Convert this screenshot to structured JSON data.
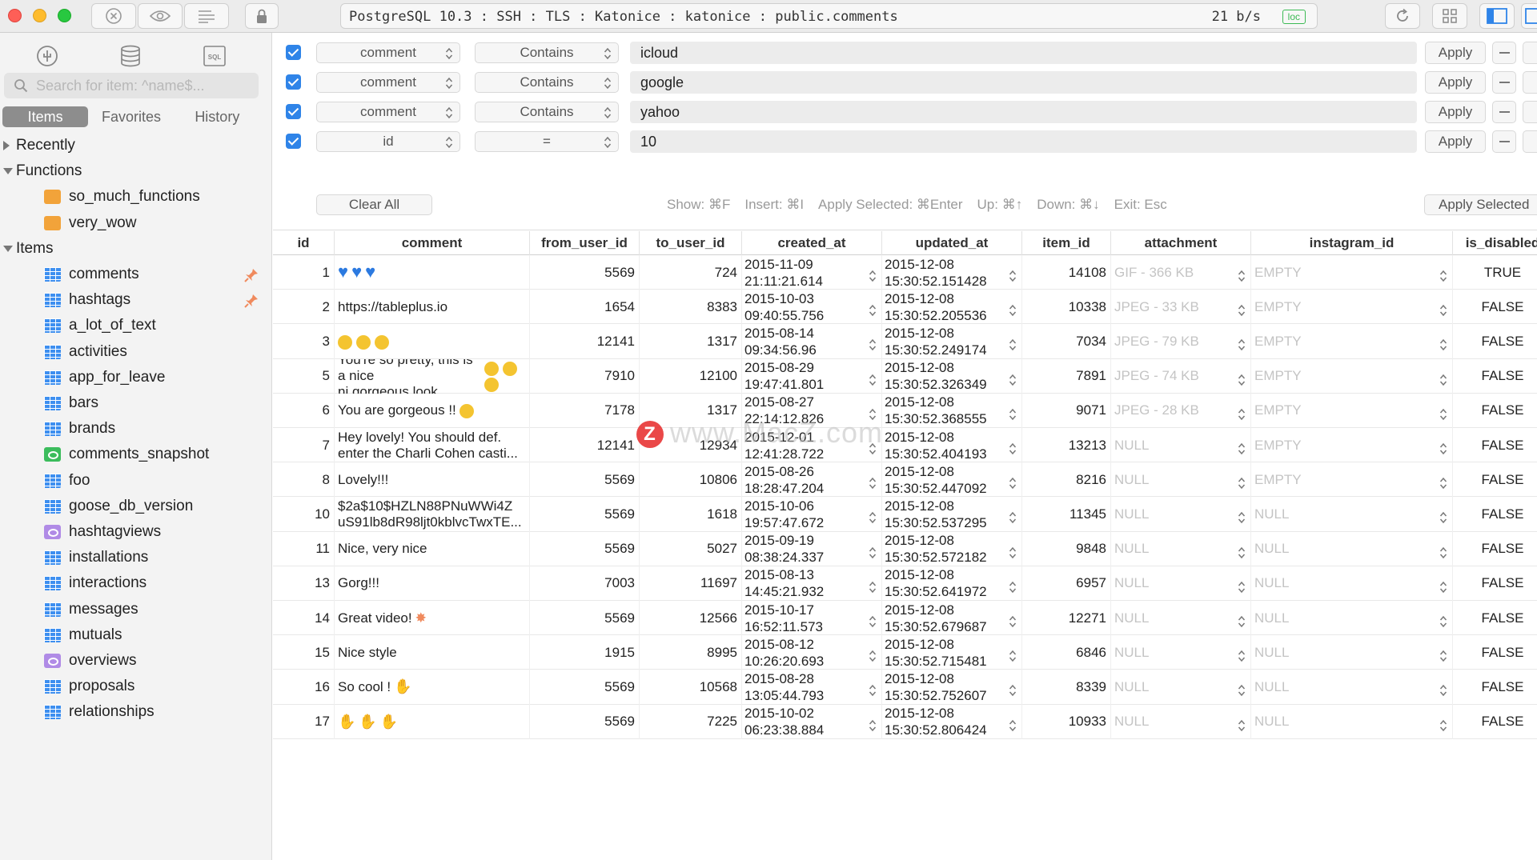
{
  "titlebar": {
    "connection": "PostgreSQL 10.3 : SSH : TLS : Katonice : katonice : public.comments",
    "speed": "21 b/s",
    "badge": "loc"
  },
  "sidebar": {
    "search_placeholder": "Search for item: ^name$...",
    "segments": [
      "Items",
      "Favorites",
      "History"
    ],
    "active_segment": "Items",
    "groups": {
      "recently": "Recently",
      "functions": "Functions",
      "items": "Items"
    },
    "functions": [
      "so_much_functions",
      "very_wow"
    ],
    "items": [
      {
        "label": "comments",
        "kind": "table",
        "pinned": true
      },
      {
        "label": "hashtags",
        "kind": "table",
        "pinned": true
      },
      {
        "label": "a_lot_of_text",
        "kind": "table"
      },
      {
        "label": "activities",
        "kind": "table"
      },
      {
        "label": "app_for_leave",
        "kind": "table"
      },
      {
        "label": "bars",
        "kind": "table"
      },
      {
        "label": "brands",
        "kind": "table"
      },
      {
        "label": "comments_snapshot",
        "kind": "materialized-view"
      },
      {
        "label": "foo",
        "kind": "table"
      },
      {
        "label": "goose_db_version",
        "kind": "table"
      },
      {
        "label": "hashtagviews",
        "kind": "view"
      },
      {
        "label": "installations",
        "kind": "table"
      },
      {
        "label": "interactions",
        "kind": "table"
      },
      {
        "label": "messages",
        "kind": "table"
      },
      {
        "label": "mutuals",
        "kind": "table"
      },
      {
        "label": "overviews",
        "kind": "view"
      },
      {
        "label": "proposals",
        "kind": "table"
      },
      {
        "label": "relationships",
        "kind": "table"
      }
    ]
  },
  "filters": {
    "rows": [
      {
        "column": "comment",
        "operator": "Contains",
        "value": "icloud"
      },
      {
        "column": "comment",
        "operator": "Contains",
        "value": "google"
      },
      {
        "column": "comment",
        "operator": "Contains",
        "value": "yahoo"
      },
      {
        "column": "id",
        "operator": "=",
        "value": "10"
      }
    ],
    "apply_label": "Apply",
    "clear_all": "Clear All",
    "hints": [
      "Show: ⌘F",
      "Insert: ⌘I",
      "Apply Selected: ⌘Enter",
      "Up: ⌘↑",
      "Down: ⌘↓",
      "Exit: Esc"
    ],
    "apply_selected": "Apply Selected"
  },
  "table": {
    "columns": [
      "id",
      "comment",
      "from_user_id",
      "to_user_id",
      "created_at",
      "updated_at",
      "item_id",
      "attachment",
      "instagram_id",
      "is_disabled"
    ],
    "rows": [
      {
        "id": "1",
        "comment": "",
        "emoji": "hearts",
        "from_user_id": "5569",
        "to_user_id": "724",
        "created_at": "2015-11-09\n21:11:21.614",
        "updated_at": "2015-12-08\n15:30:52.151428",
        "item_id": "14108",
        "attachment": "GIF - 366 KB",
        "instagram_id": "EMPTY",
        "is_disabled": "TRUE"
      },
      {
        "id": "2",
        "comment": "https://tableplus.io",
        "from_user_id": "1654",
        "to_user_id": "8383",
        "created_at": "2015-10-03\n09:40:55.756",
        "updated_at": "2015-12-08\n15:30:52.205536",
        "item_id": "10338",
        "attachment": "JPEG - 33 KB",
        "instagram_id": "EMPTY",
        "is_disabled": "FALSE"
      },
      {
        "id": "3",
        "comment": "",
        "emoji": "smiles",
        "from_user_id": "12141",
        "to_user_id": "1317",
        "created_at": "2015-08-14\n09:34:56.96",
        "updated_at": "2015-12-08\n15:30:52.249174",
        "item_id": "7034",
        "attachment": "JPEG - 79 KB",
        "instagram_id": "EMPTY",
        "is_disabled": "FALSE"
      },
      {
        "id": "5",
        "comment": "You're so pretty, this is a nice\nni gorgeous look",
        "emoji": "smiles-trail",
        "from_user_id": "7910",
        "to_user_id": "12100",
        "created_at": "2015-08-29\n19:47:41.801",
        "updated_at": "2015-12-08\n15:30:52.326349",
        "item_id": "7891",
        "attachment": "JPEG - 74 KB",
        "instagram_id": "EMPTY",
        "is_disabled": "FALSE"
      },
      {
        "id": "6",
        "comment": "You are gorgeous !!",
        "emoji": "heart-eyes",
        "from_user_id": "7178",
        "to_user_id": "1317",
        "created_at": "2015-08-27\n22:14:12.826",
        "updated_at": "2015-12-08\n15:30:52.368555",
        "item_id": "9071",
        "attachment": "JPEG - 28 KB",
        "instagram_id": "EMPTY",
        "is_disabled": "FALSE"
      },
      {
        "id": "7",
        "comment": "Hey lovely! You should def.\nenter the Charli Cohen casti...",
        "from_user_id": "12141",
        "to_user_id": "12934",
        "created_at": "2015-12-01\n12:41:28.722",
        "updated_at": "2015-12-08\n15:30:52.404193",
        "item_id": "13213",
        "attachment": "NULL",
        "instagram_id": "EMPTY",
        "is_disabled": "FALSE"
      },
      {
        "id": "8",
        "comment": "Lovely!!!",
        "from_user_id": "5569",
        "to_user_id": "10806",
        "created_at": "2015-08-26\n18:28:47.204",
        "updated_at": "2015-12-08\n15:30:52.447092",
        "item_id": "8216",
        "attachment": "NULL",
        "instagram_id": "EMPTY",
        "is_disabled": "FALSE"
      },
      {
        "id": "10",
        "comment": "$2a$10$HZLN88PNuWWi4Z\nuS91lb8dR98ljt0kblvcTwxTE...",
        "from_user_id": "5569",
        "to_user_id": "1618",
        "created_at": "2015-10-06\n19:57:47.672",
        "updated_at": "2015-12-08\n15:30:52.537295",
        "item_id": "11345",
        "attachment": "NULL",
        "instagram_id": "NULL",
        "is_disabled": "FALSE"
      },
      {
        "id": "11",
        "comment": "Nice, very nice",
        "from_user_id": "5569",
        "to_user_id": "5027",
        "created_at": "2015-09-19\n08:38:24.337",
        "updated_at": "2015-12-08\n15:30:52.572182",
        "item_id": "9848",
        "attachment": "NULL",
        "instagram_id": "NULL",
        "is_disabled": "FALSE"
      },
      {
        "id": "13",
        "comment": "Gorg!!!",
        "from_user_id": "7003",
        "to_user_id": "11697",
        "created_at": "2015-08-13\n14:45:21.932",
        "updated_at": "2015-12-08\n15:30:52.641972",
        "item_id": "6957",
        "attachment": "NULL",
        "instagram_id": "NULL",
        "is_disabled": "FALSE"
      },
      {
        "id": "14",
        "comment": "Great video!",
        "emoji": "boom",
        "from_user_id": "5569",
        "to_user_id": "12566",
        "created_at": "2015-10-17\n16:52:11.573",
        "updated_at": "2015-12-08\n15:30:52.679687",
        "item_id": "12271",
        "attachment": "NULL",
        "instagram_id": "NULL",
        "is_disabled": "FALSE"
      },
      {
        "id": "15",
        "comment": "Nice style",
        "from_user_id": "1915",
        "to_user_id": "8995",
        "created_at": "2015-08-12\n10:26:20.693",
        "updated_at": "2015-12-08\n15:30:52.715481",
        "item_id": "6846",
        "attachment": "NULL",
        "instagram_id": "NULL",
        "is_disabled": "FALSE"
      },
      {
        "id": "16",
        "comment": "So cool !",
        "emoji": "clap",
        "from_user_id": "5569",
        "to_user_id": "10568",
        "created_at": "2015-08-28\n13:05:44.793",
        "updated_at": "2015-12-08\n15:30:52.752607",
        "item_id": "8339",
        "attachment": "NULL",
        "instagram_id": "NULL",
        "is_disabled": "FALSE"
      },
      {
        "id": "17",
        "comment": "",
        "emoji": "claps",
        "from_user_id": "5569",
        "to_user_id": "7225",
        "created_at": "2015-10-02\n06:23:38.884",
        "updated_at": "2015-12-08\n15:30:52.806424",
        "item_id": "10933",
        "attachment": "NULL",
        "instagram_id": "NULL",
        "is_disabled": "FALSE"
      }
    ]
  },
  "watermark": {
    "text": "www.MacZ.com",
    "letter": "Z"
  },
  "colors": {
    "accent": "#2f84e8",
    "table_icon": "#3d8ff0",
    "function_icon": "#f2a33a",
    "view_icon": "#b08be6",
    "mview_icon": "#3bbc5c",
    "dim_text": "#c4c4c4"
  }
}
